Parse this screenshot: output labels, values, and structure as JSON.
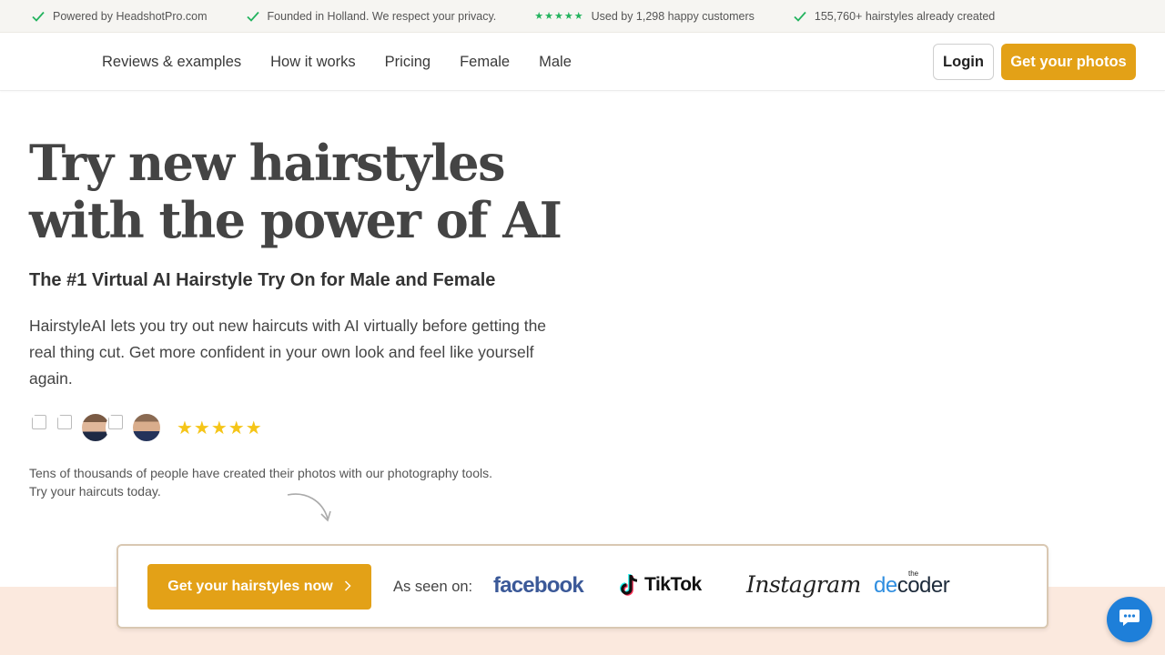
{
  "topbar": {
    "items": [
      {
        "icon": "check-icon",
        "text": "Powered by HeadshotPro.com"
      },
      {
        "icon": "check-icon",
        "text": "Founded in Holland. We respect your privacy."
      },
      {
        "icon": "green-stars-icon",
        "text": "Used by 1,298 happy customers",
        "stars": "★★★★★"
      },
      {
        "icon": "check-icon",
        "text": "155,760+ hairstyles already created"
      }
    ]
  },
  "nav": {
    "links": [
      "Reviews & examples",
      "How it works",
      "Pricing",
      "Female",
      "Male"
    ],
    "login": "Login",
    "cta": "Get your photos"
  },
  "hero": {
    "title_line1": "Try new hairstyles",
    "title_line2": "with the power of AI",
    "subtitle": "The #1 Virtual AI Hairstyle Try On for Male and Female",
    "description": "HairstyleAI lets you try out new haircuts with AI virtually before getting the real thing cut. Get more confident in your own look and feel like yourself again.",
    "rating_stars": "★★★★★",
    "social_proof": "Tens of thousands of people have created their photos with our photography tools. Try your haircuts today."
  },
  "cta_card": {
    "button": "Get your hairstyles now",
    "seen_on": "As seen on:",
    "logos": {
      "facebook": "facebook",
      "tiktok": "TikTok",
      "instagram": "Instagram",
      "decoder_the": "the",
      "decoder_a": "de",
      "decoder_b": "coder"
    }
  },
  "colors": {
    "accent": "#e3a117",
    "check": "#22b35e",
    "stars": "#f5c518",
    "band": "#fbe9de",
    "chat": "#1e7fd9"
  }
}
